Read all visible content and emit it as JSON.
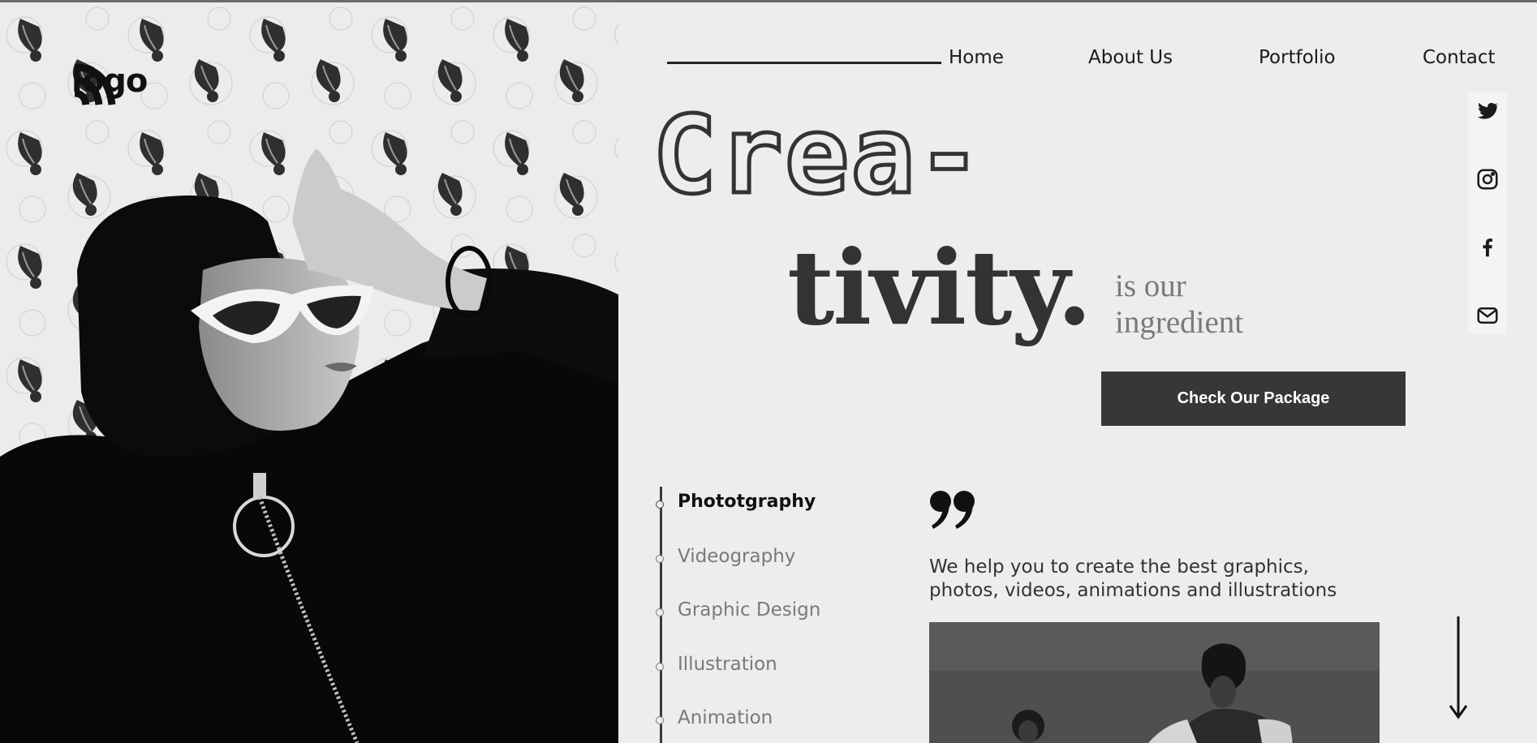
{
  "brand": {
    "logo_text": "logo",
    "logo_icon": "wifi-arc-logo-icon"
  },
  "nav": {
    "items": [
      {
        "label": "Home",
        "icon": null
      },
      {
        "label": "About Us",
        "icon": null
      },
      {
        "label": "Portfolio",
        "icon": null
      },
      {
        "label": "Contact",
        "icon": null
      }
    ]
  },
  "social": {
    "items": [
      {
        "name": "Twitter",
        "icon": "twitter-icon"
      },
      {
        "name": "Instagram",
        "icon": "instagram-icon"
      },
      {
        "name": "Facebook",
        "icon": "facebook-icon"
      },
      {
        "name": "Mail",
        "icon": "mail-icon"
      }
    ]
  },
  "hero": {
    "headline_line1": "Crea-",
    "headline_line2": "tivity.",
    "tagline_line1": "is our",
    "tagline_line2": "ingredient",
    "cta_label": "Check Our Package"
  },
  "services": {
    "items": [
      {
        "label": "Phototgraphy",
        "active": true
      },
      {
        "label": "Videography",
        "active": false
      },
      {
        "label": "Graphic Design",
        "active": false
      },
      {
        "label": "Illustration",
        "active": false
      },
      {
        "label": "Animation",
        "active": false
      }
    ]
  },
  "quote": {
    "text_line1": "We help you to create the best graphics,",
    "text_line2": "photos, videos, animations and illustrations"
  },
  "colors": {
    "background": "#ededed",
    "primary_dark": "#373737",
    "muted_text": "#7a7a7a",
    "social_bar": "#f6f3f3"
  }
}
